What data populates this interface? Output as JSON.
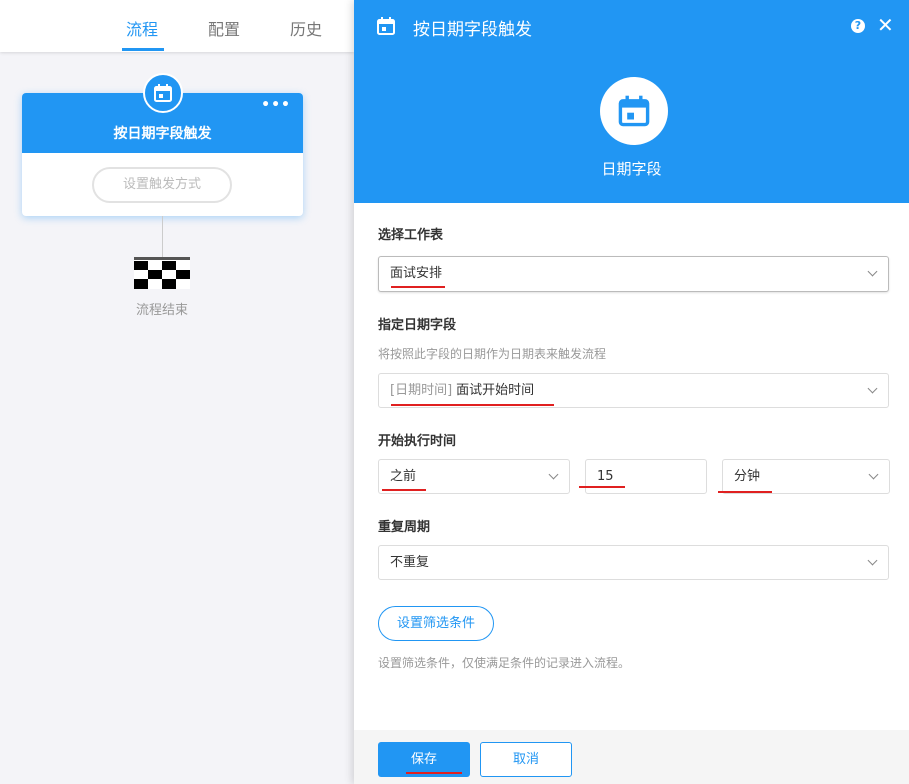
{
  "tabs": [
    {
      "label": "流程",
      "active": true
    },
    {
      "label": "配置",
      "active": false
    },
    {
      "label": "历史",
      "active": false
    }
  ],
  "node": {
    "title": "按日期字段触发",
    "menu": "•••",
    "action_label": "设置触发方式",
    "icon": "calendar-icon"
  },
  "end": {
    "label": "流程结束",
    "icon": "checkered-flag-icon"
  },
  "panel": {
    "title": "按日期字段触发",
    "help": "?",
    "close": "✕",
    "type_label": "日期字段",
    "accent": "#2196f3",
    "worksheet": {
      "label": "选择工作表",
      "value": "面试安排"
    },
    "date_field": {
      "label": "指定日期字段",
      "hint": "将按照此字段的日期作为日期表来触发流程",
      "prefix": "[日期时间]",
      "value": "面试开始时间"
    },
    "start_time": {
      "label": "开始执行时间",
      "direction": "之前",
      "amount": "15",
      "unit": "分钟"
    },
    "repeat": {
      "label": "重复周期",
      "value": "不重复"
    },
    "filter": {
      "button": "设置筛选条件",
      "hint": "设置筛选条件，仅使满足条件的记录进入流程。"
    },
    "footer": {
      "save": "保存",
      "cancel": "取消"
    }
  }
}
